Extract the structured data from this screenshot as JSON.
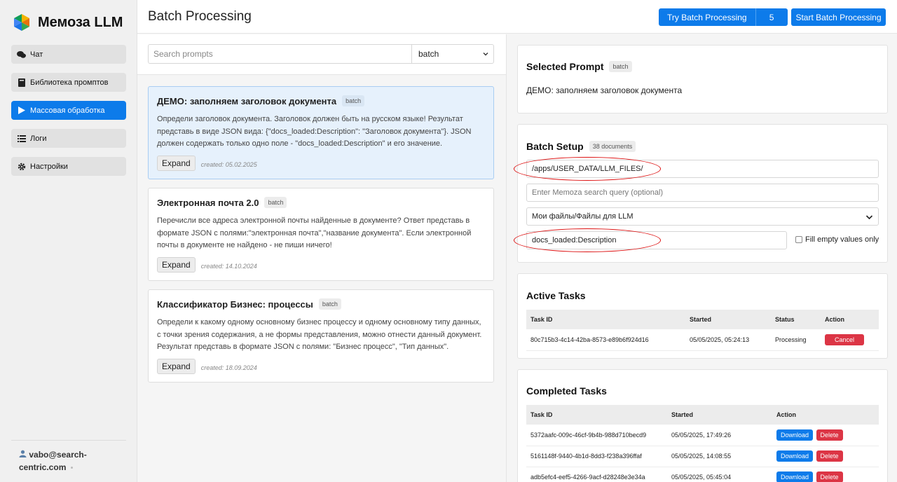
{
  "app": {
    "name": "Мемоза LLM"
  },
  "sidebar": {
    "items": [
      {
        "label": "Чат",
        "icon": "chat-icon"
      },
      {
        "label": "Библиотека промптов",
        "icon": "book-icon"
      },
      {
        "label": "Массовая обработка",
        "icon": "play-icon",
        "active": true
      },
      {
        "label": "Логи",
        "icon": "list-icon"
      },
      {
        "label": "Настройки",
        "icon": "gear-icon"
      }
    ],
    "user": "vabo@search-centric.com"
  },
  "header": {
    "title": "Batch Processing",
    "try_label": "Try Batch Processing",
    "try_count": "5",
    "start_label": "Start Batch Processing"
  },
  "prompts": {
    "search_placeholder": "Search prompts",
    "filter_value": "batch",
    "expand_label": "Expand",
    "cards": [
      {
        "title": "ДЕМО: заполняем заголовок документа",
        "badge": "batch",
        "text": "Определи заголовок документа. Заголовок должен быть на русском языке! Результат представь в виде JSON вида: {\"docs_loaded:Description\": \"Заголовок документа\"}. JSON должен содержать только одно поле - \"docs_loaded:Description\" и его значение.",
        "created": "created: 05.02.2025"
      },
      {
        "title": "Электронная почта 2.0",
        "badge": "batch",
        "text": "Перечисли все адреса электронной почты найденные в документе? Ответ представь в формате JSON с полями:\"электронная почта\",\"название документа\". Если электронной почты в документе не найдено - не пиши ничего!",
        "created": "created: 14.10.2024"
      },
      {
        "title": "Классификатор Бизнес: процессы",
        "badge": "batch",
        "text": "Определи к какому одному основному бизнес процессу и одному основному типу данных, с точки зрения содержания, а не формы представления, можно отнести данный документ. Результат представь в формате JSON с полями: \"Бизнес процесс\", \"Тип данных\".",
        "created": "created: 18.09.2024"
      }
    ]
  },
  "selected_prompt": {
    "heading": "Selected Prompt",
    "badge": "batch",
    "text": "ДЕМО: заполняем заголовок документа"
  },
  "batch_setup": {
    "heading": "Batch Setup",
    "doc_count": "38 documents",
    "path_value": "/apps/USER_DATA/LLM_FILES/",
    "query_placeholder": "Enter Memoza search query (optional)",
    "folder_value": "Мои файлы/Файлы для LLM",
    "field_value": "docs_loaded:Description",
    "fill_empty_label": "Fill empty values only",
    "annotation_color": "#dd1111"
  },
  "active_tasks": {
    "heading": "Active Tasks",
    "columns": [
      "Task ID",
      "Started",
      "Status",
      "Action"
    ],
    "rows": [
      {
        "id": "80c715b3-4c14-42ba-8573-e89b6f924d16",
        "started": "05/05/2025, 05:24:13",
        "status": "Processing",
        "action": "Cancel"
      }
    ]
  },
  "completed_tasks": {
    "heading": "Completed Tasks",
    "columns": [
      "Task ID",
      "Started",
      "Action"
    ],
    "download_label": "Download",
    "delete_label": "Delete",
    "rows": [
      {
        "id": "5372aafc-009c-46cf-9b4b-988d710becd9",
        "started": "05/05/2025, 17:49:26"
      },
      {
        "id": "5161148f-9440-4b1d-8dd3-f238a396ffaf",
        "started": "05/05/2025, 14:08:55"
      },
      {
        "id": "adb5efc4-eef5-4266-9acf-d28248e3e34a",
        "started": "05/05/2025, 05:45:04"
      }
    ]
  },
  "colors": {
    "accent": "#0d7bea",
    "danger": "#dc3545",
    "selected_card": "#e6f1fc"
  }
}
